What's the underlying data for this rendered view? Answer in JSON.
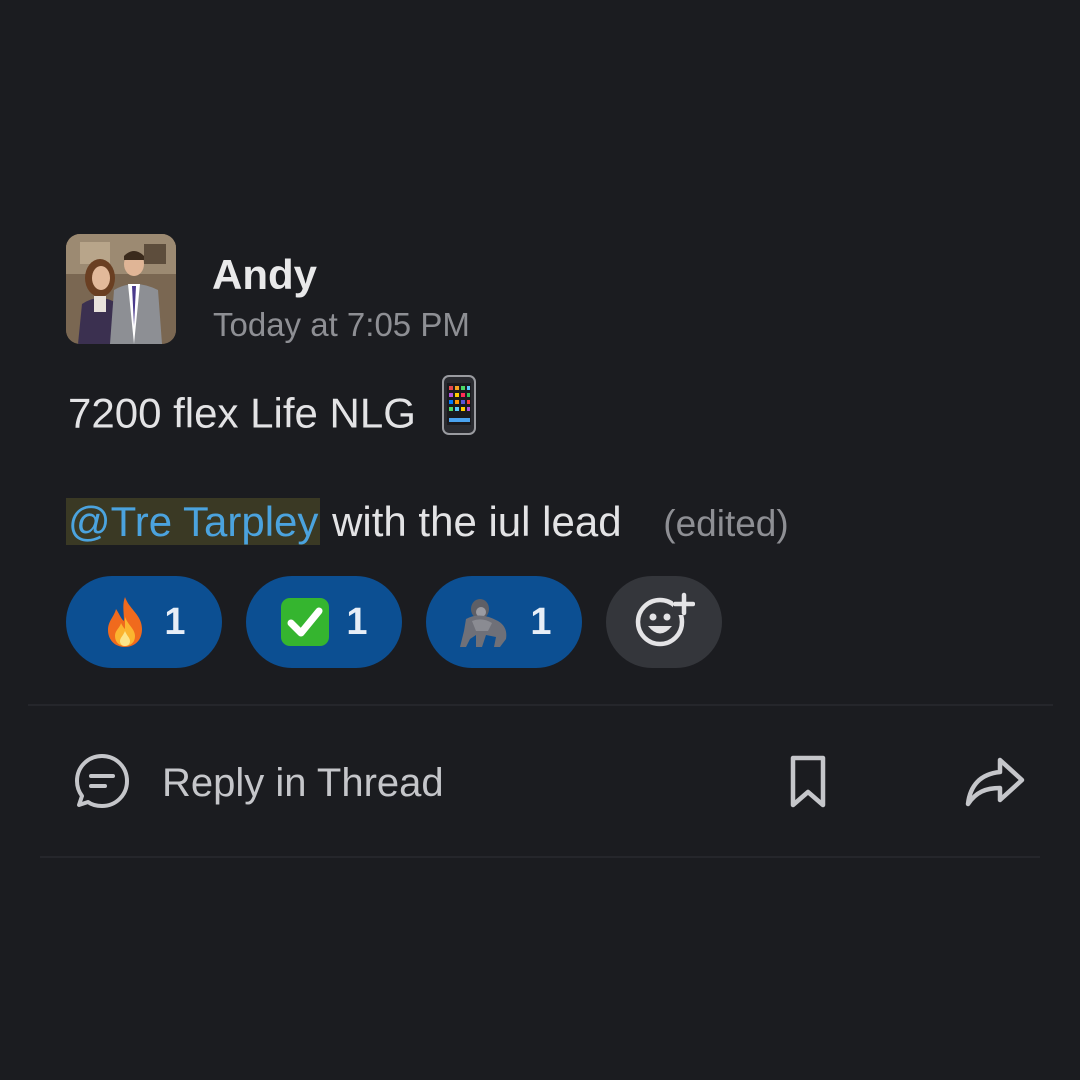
{
  "message": {
    "author": "Andy",
    "timestamp": "Today at 7:05 PM",
    "line1_text": "7200 flex Life NLG",
    "line1_emoji": "mobile-phone-emoji",
    "mention": "@Tre Tarpley",
    "line2_text": "with the iul lead",
    "edited_label": "(edited)"
  },
  "reactions": [
    {
      "emoji": "fire-emoji",
      "count": "1"
    },
    {
      "emoji": "check-mark-emoji",
      "count": "1"
    },
    {
      "emoji": "gorilla-emoji",
      "count": "1"
    }
  ],
  "actions": {
    "reply_label": "Reply in Thread",
    "save_icon": "bookmark-icon",
    "share_icon": "share-arrow-icon"
  },
  "colors": {
    "background": "#1b1c20",
    "mention_text": "#4ba3de",
    "mention_highlight": "#3a3924",
    "reaction_active": "#0c4f92",
    "reaction_add": "#34363b"
  }
}
